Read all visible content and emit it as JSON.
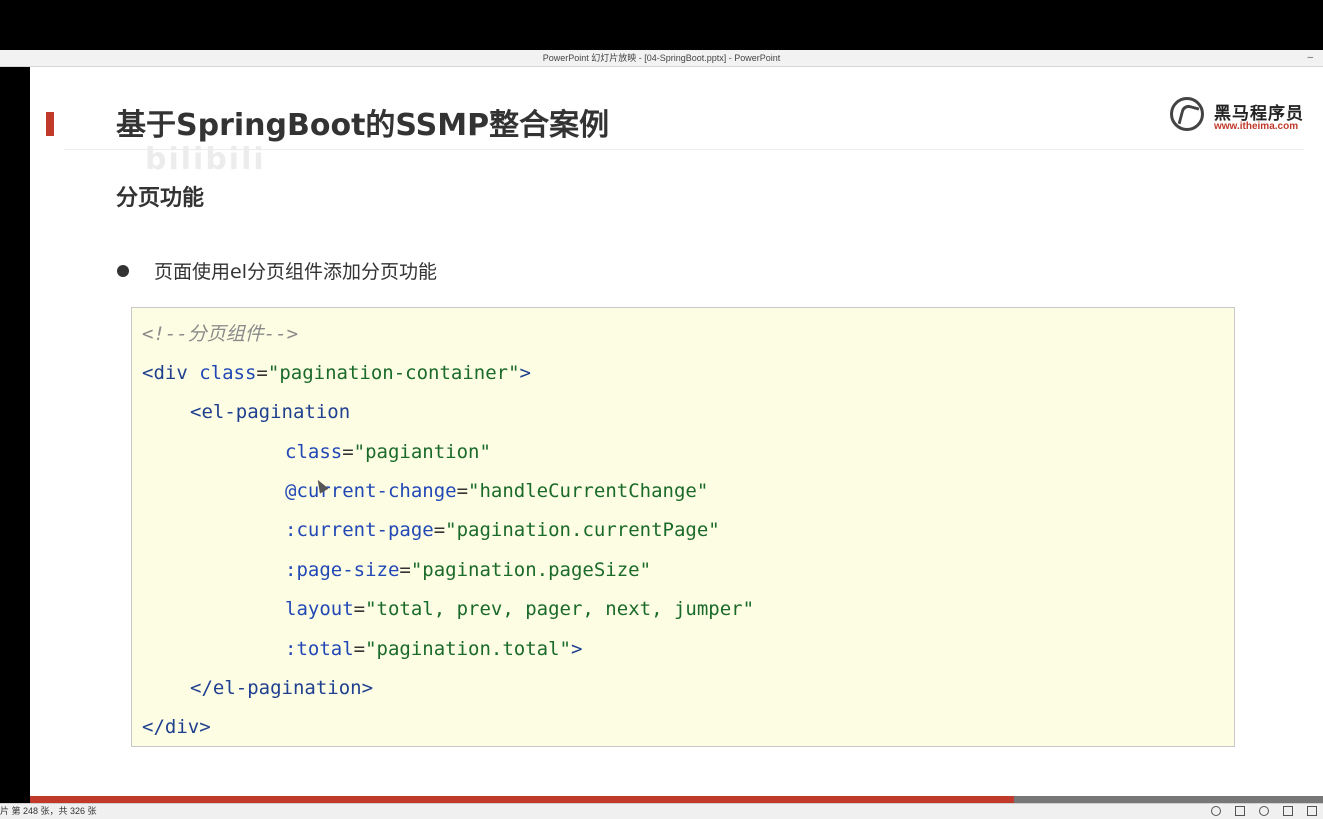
{
  "window": {
    "title": "PowerPoint 幻灯片放映 - [04-SpringBoot.pptx] - PowerPoint",
    "minimize_glyph": "–"
  },
  "slide": {
    "title": "基于SpringBoot的SSMP整合案例",
    "watermark_text": "bilibili",
    "watermark_left": "黑",
    "logo": {
      "name": "黑马程序员",
      "url": "www.itheima.com"
    },
    "section_heading": "分页功能",
    "bullet": "页面使用el分页组件添加分页功能",
    "code": {
      "comment": "<!--分页组件-->",
      "l1_open": "<div",
      "l1_attr": "class",
      "l1_val": "\"pagination-container\"",
      "l1_close": ">",
      "l2_open": "<el-pagination",
      "l3_attr": "class",
      "l3_val": "\"pagiantion\"",
      "l4_attr": "@current-change",
      "l4_val": "\"handleCurrentChange\"",
      "l5_attr": ":current-page",
      "l5_val": "\"pagination.currentPage\"",
      "l6_attr": ":page-size",
      "l6_val": "\"pagination.pageSize\"",
      "l7_attr": "layout",
      "l7_val": "\"total, prev, pager, next, jumper\"",
      "l8_attr": ":total",
      "l8_val": "\"pagination.total\"",
      "l8_close": ">",
      "l9": "</el-pagination>",
      "l10": "</div>",
      "eq": "="
    }
  },
  "progress": {
    "current": 248,
    "total": 326
  },
  "status": {
    "slide_text": "片 第 248 张，共 326 张"
  },
  "colors": {
    "accent": "#c0392b",
    "code_bg": "#fdfde4"
  }
}
